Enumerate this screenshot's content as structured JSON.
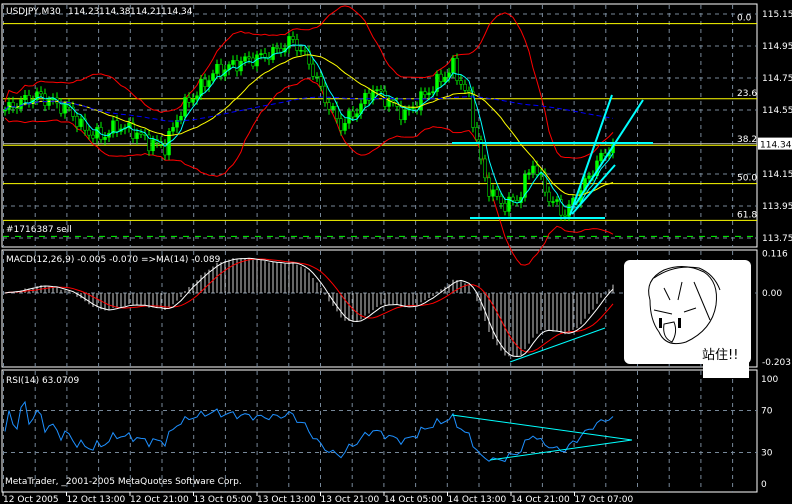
{
  "header": {
    "symbol": "USDJPY,M30",
    "open": "114.23",
    "high": "114.38",
    "low": "114.21",
    "close": "114.34"
  },
  "order_label": "#1716387 sell",
  "macd": {
    "label": "MACD(12,26,9) -0.005 -0.070  =>MA(14) -0.089",
    "axis": [
      "0.116",
      "0.00",
      "-0.203"
    ]
  },
  "rsi": {
    "label": "RSI(14) 63.0709",
    "axis": [
      "100",
      "70",
      "30",
      "0"
    ]
  },
  "copyright": "MetaTrader, _2001-2005 MetaQuotes Software Corp.",
  "sticker": {
    "text": "站住!!"
  },
  "colors": {
    "background": "#000000",
    "bull": "#00ff00",
    "fib": "#ffff00",
    "bands": "#ff0000",
    "fast_ma": "#00ffff",
    "slow_ma": "#0000ff",
    "trendline": "#00ffff",
    "rsi": "#1e90ff",
    "order": "#00ff00"
  },
  "chart_data": {
    "type": "candlestick",
    "timeframe": "M30",
    "price_axis": [
      "115.15",
      "114.95",
      "114.75",
      "114.55",
      "114.34",
      "114.15",
      "113.95",
      "113.75"
    ],
    "current_price": 114.34,
    "ylim": [
      113.72,
      115.2
    ],
    "time_axis": [
      "12 Oct 2005",
      "12 Oct 13:00",
      "12 Oct 21:00",
      "13 Oct 05:00",
      "13 Oct 13:00",
      "13 Oct 21:00",
      "14 Oct 05:00",
      "14 Oct 13:00",
      "14 Oct 21:00",
      "17 Oct 07:00"
    ],
    "close_sampled_2h": [
      114.55,
      114.6,
      114.64,
      114.6,
      114.55,
      114.42,
      114.38,
      114.45,
      114.42,
      114.35,
      114.32,
      114.55,
      114.66,
      114.78,
      114.82,
      114.86,
      114.88,
      114.92,
      114.99,
      114.85,
      114.62,
      114.45,
      114.55,
      114.68,
      114.6,
      114.52,
      114.62,
      114.72,
      114.82,
      114.62,
      114.1,
      113.96,
      113.98,
      114.22,
      114.0,
      113.9,
      114.05,
      114.22,
      114.34
    ],
    "fibonacci": [
      {
        "level": "0.0",
        "price": 115.09
      },
      {
        "level": "23.6",
        "price": 114.62
      },
      {
        "level": "38.2",
        "price": 114.33
      },
      {
        "level": "50.0",
        "price": 114.09
      },
      {
        "level": "61.8",
        "price": 113.86
      }
    ],
    "order_price": 113.76,
    "macd_range": [
      -0.203,
      0.116
    ],
    "rsi_range": [
      0,
      100
    ],
    "rsi_levels": [
      70,
      30
    ]
  }
}
